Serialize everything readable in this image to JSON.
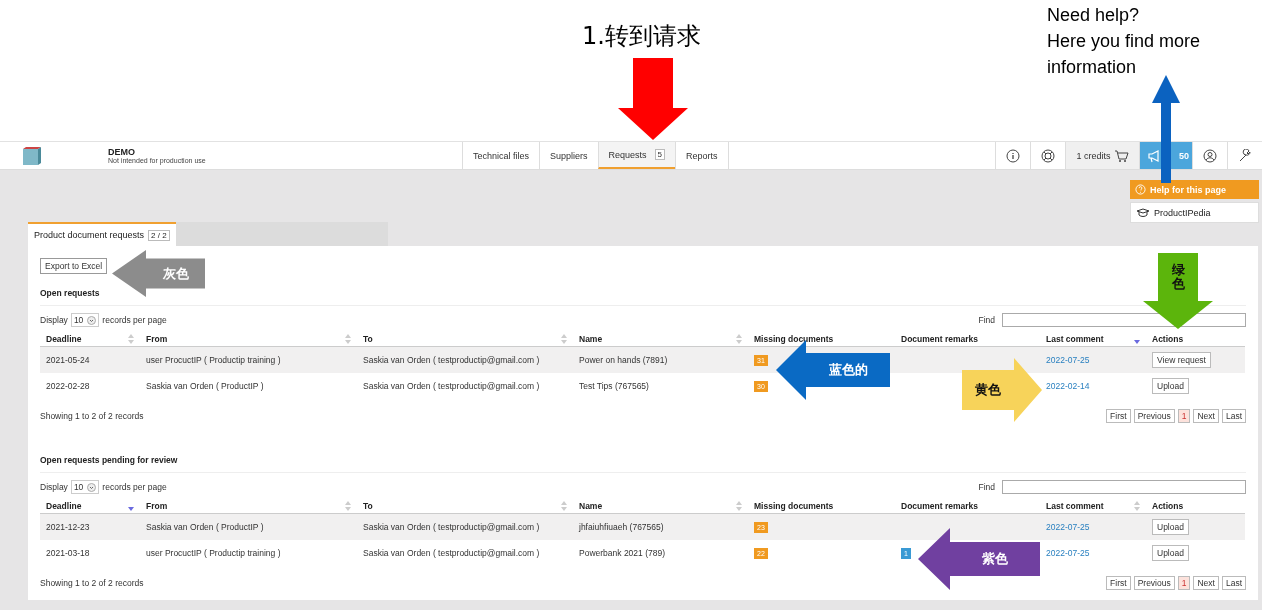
{
  "annotations": {
    "title": "1.转到请求",
    "help_note": [
      "Need help?",
      "Here you find more information"
    ],
    "arrows": [
      {
        "kind": "down",
        "color": "#ff0000"
      },
      {
        "kind": "up",
        "color": "#0b62c0"
      },
      {
        "kind": "left",
        "color": "#8c8c8c",
        "label": "灰色"
      },
      {
        "kind": "down",
        "color": "#5cb50c",
        "label": "绿色"
      },
      {
        "kind": "left",
        "color": "#0a6ac4",
        "label": "蓝色的"
      },
      {
        "kind": "right",
        "color": "#f7d35a",
        "label": "黄色"
      },
      {
        "kind": "left",
        "color": "#7040a0",
        "label": "紫色"
      }
    ]
  },
  "header": {
    "title": "DEMO",
    "subtitle": "Not intended for production use",
    "nav": [
      {
        "label": "Technical files",
        "selected": false
      },
      {
        "label": "Suppliers",
        "selected": false
      },
      {
        "label": "Requests",
        "count": "5",
        "selected": true
      },
      {
        "label": "Reports",
        "selected": false
      }
    ],
    "tools": [
      {
        "kind": "info"
      },
      {
        "kind": "support"
      },
      {
        "kind": "credits",
        "label": "1 credits"
      },
      {
        "kind": "notifications",
        "label": "50"
      },
      {
        "kind": "account"
      },
      {
        "kind": "settings"
      }
    ]
  },
  "help_menu": [
    {
      "kind": "help",
      "label": "Help for this page"
    },
    {
      "kind": "wiki",
      "label": "ProductIPedia"
    }
  ],
  "tabs": [
    {
      "label": "Product document requests",
      "count": "2 / 2",
      "selected": true
    }
  ],
  "export_button": "Export to Excel",
  "sections": [
    {
      "title": "Open requests",
      "display_label": "Display",
      "page_size": "10",
      "per_page_label": "records per page",
      "find_label": "Find",
      "columns": [
        {
          "label": "Deadline",
          "sorted": false
        },
        {
          "label": "From",
          "sorted": false
        },
        {
          "label": "To",
          "sorted": false
        },
        {
          "label": "Name",
          "sorted": false
        },
        {
          "label": "Missing documents"
        },
        {
          "label": "Document remarks"
        },
        {
          "label": "Last comment",
          "sorted": true
        },
        {
          "label": "Actions"
        }
      ],
      "rows": [
        {
          "deadline": "2021-05-24",
          "from": "user ProcuctIP ( Productip training )",
          "to": "Saskia van Orden ( testproductip@gmail.com )",
          "name": "Power on hands (7891)",
          "missing": "31",
          "last_comment": "2022-07-25",
          "action": "View request"
        },
        {
          "deadline": "2022-02-28",
          "from": "Saskia van Orden ( ProductIP )",
          "to": "Saskia van Orden ( testproductip@gmail.com )",
          "name": "Test Tips (767565)",
          "missing": "30",
          "last_comment": "2022-02-14",
          "action": "Upload"
        }
      ],
      "info": "Showing 1 to 2 of 2 records",
      "pagination": [
        {
          "label": "First",
          "selected": false
        },
        {
          "label": "Previous",
          "selected": false
        },
        {
          "label": "1",
          "selected": true
        },
        {
          "label": "Next",
          "selected": false
        },
        {
          "label": "Last",
          "selected": false
        }
      ]
    },
    {
      "title": "Open requests pending for review",
      "display_label": "Display",
      "page_size": "10",
      "per_page_label": "records per page",
      "find_label": "Find",
      "columns": [
        {
          "label": "Deadline",
          "sorted": true
        },
        {
          "label": "From",
          "sorted": false
        },
        {
          "label": "To",
          "sorted": false
        },
        {
          "label": "Name",
          "sorted": false
        },
        {
          "label": "Missing documents"
        },
        {
          "label": "Document remarks"
        },
        {
          "label": "Last comment",
          "sorted": false
        },
        {
          "label": "Actions"
        }
      ],
      "rows": [
        {
          "deadline": "2021-12-23",
          "from": "Saskia van Orden ( ProductIP )",
          "to": "Saskia van Orden ( testproductip@gmail.com )",
          "name": "jhfaiuhfiuaeh (767565)",
          "missing": "23",
          "last_comment": "2022-07-25",
          "action": "Upload"
        },
        {
          "deadline": "2021-03-18",
          "from": "user ProcuctIP ( Productip training )",
          "to": "Saskia van Orden ( testproductip@gmail.com )",
          "name": "Powerbank 2021 (789)",
          "missing": "22",
          "remarks": "1",
          "last_comment": "2022-07-25",
          "action": "Upload"
        }
      ],
      "info": "Showing 1 to 2 of 2 records",
      "pagination": [
        {
          "label": "First",
          "selected": false
        },
        {
          "label": "Previous",
          "selected": false
        },
        {
          "label": "1",
          "selected": true
        },
        {
          "label": "Next",
          "selected": false
        },
        {
          "label": "Last",
          "selected": false
        }
      ]
    }
  ]
}
